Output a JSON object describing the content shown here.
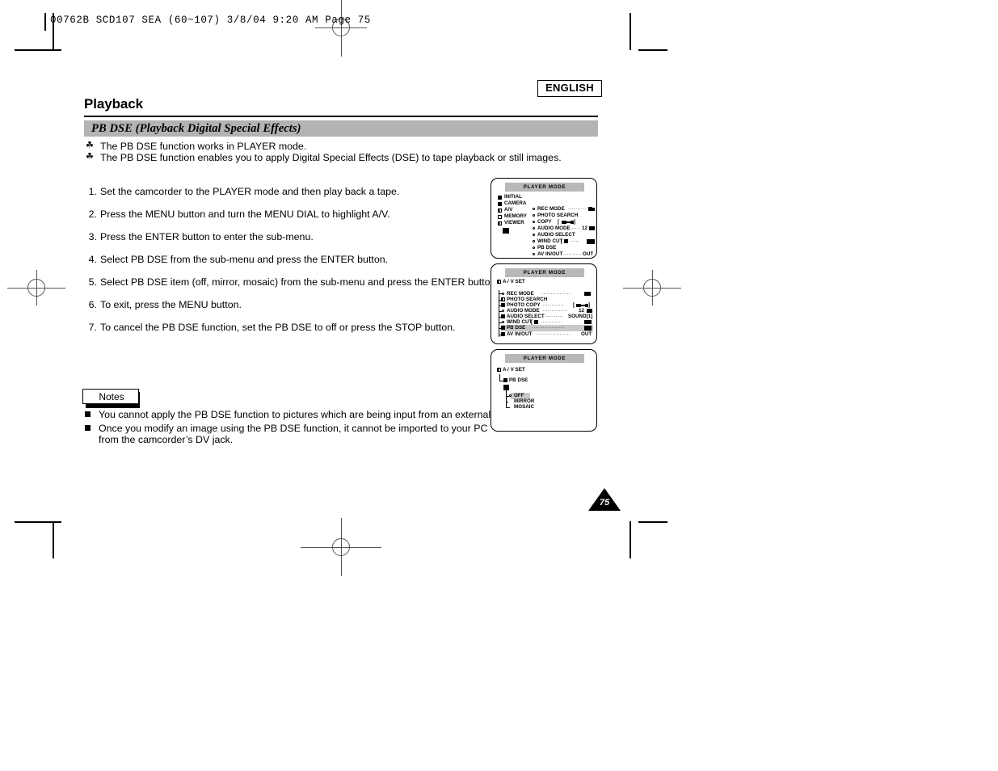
{
  "print_slug": "00762B SCD107 SEA (60~107)   3/8/04 9:20 AM   Page 75",
  "header": {
    "language_badge": "ENGLISH",
    "page_title": "Playback",
    "section_title": "PB DSE (Playback Digital Special Effects)"
  },
  "intro_bullets": [
    {
      "marker": "☘",
      "text": "The PB DSE function works in PLAYER mode."
    },
    {
      "marker": "☘",
      "text": "The PB DSE function enables you to apply Digital Special Effects (DSE) to tape playback or still images."
    }
  ],
  "steps": [
    {
      "num": "1.",
      "text": "Set the camcorder to the PLAYER mode and then play back a tape."
    },
    {
      "num": "2.",
      "text": "Press the MENU button and turn the MENU DIAL to highlight A/V."
    },
    {
      "num": "3.",
      "text": "Press the ENTER button to enter the sub-menu."
    },
    {
      "num": "4.",
      "text": "Select PB DSE from the sub-menu and press the ENTER button."
    },
    {
      "num": "5.",
      "text": "Select PB DSE item (off, mirror, mosaic) from the sub-menu and press the ENTER button."
    },
    {
      "num": "6.",
      "text": "To exit, press the MENU button."
    },
    {
      "num": "7.",
      "text": "To cancel the PB DSE function, set the PB DSE to off or press the STOP button."
    }
  ],
  "notes": {
    "label": "Notes",
    "items": [
      {
        "line1": "You cannot apply the PB DSE function to pictures which are being input from an external source.",
        "line2": ""
      },
      {
        "line1": "Once you modify an image using the PB DSE function, it cannot be imported to your PC",
        "line2": "from the camcorder’s DV jack."
      }
    ]
  },
  "page_number": "75",
  "lcd_screens": [
    {
      "id": "lcd-main-menu",
      "title": "PLAYER MODE",
      "left_column": [
        "INITIAL",
        "CAMERA",
        "A/V",
        "MEMORY",
        "VIEWER"
      ],
      "right_column": [
        {
          "label": "REC MODE",
          "dots": "··········",
          "value": ""
        },
        {
          "label": "PHOTO SEARCH",
          "dots": "",
          "value": ""
        },
        {
          "label": "COPY",
          "dots": "",
          "value": ""
        },
        {
          "label": "AUDIO MODE",
          "dots": "······",
          "value": "12"
        },
        {
          "label": "AUDIO SELECT",
          "dots": "",
          "value": ""
        },
        {
          "label": "WIND CUT",
          "dots": "·····",
          "value": ""
        },
        {
          "label": "PB DSE",
          "dots": "",
          "value": ""
        },
        {
          "label": "AV IN/OUT",
          "dots": "··········",
          "value": "OUT"
        }
      ]
    },
    {
      "id": "lcd-av-set-submenu",
      "title": "PLAYER MODE",
      "breadcrumb": "A / V SET",
      "items": [
        {
          "label": "REC MODE",
          "dots": "················",
          "value": "",
          "highlight": false
        },
        {
          "label": "PHOTO SEARCH",
          "dots": "",
          "value": "",
          "highlight": false
        },
        {
          "label": "PHOTO COPY",
          "dots": "············",
          "value": "",
          "highlight": false
        },
        {
          "label": "AUDIO MODE",
          "dots": "··············",
          "value": "12",
          "highlight": false
        },
        {
          "label": "AUDIO SELECT",
          "dots": "··········",
          "value": "SOUND[1]",
          "highlight": false
        },
        {
          "label": "WIND CUT",
          "dots": "············",
          "value": "",
          "highlight": false
        },
        {
          "label": "PB DSE",
          "dots": "··················",
          "value": "",
          "highlight": true
        },
        {
          "label": "AV IN/OUT",
          "dots": "···················",
          "value": "OUT",
          "highlight": false
        }
      ]
    },
    {
      "id": "lcd-pb-dse-options",
      "title": "PLAYER MODE",
      "breadcrumb": "A / V SET",
      "submenu": "PB DSE",
      "options": [
        {
          "label": "OFF",
          "selected": true
        },
        {
          "label": "MIRROR",
          "selected": false
        },
        {
          "label": "MOSAIC",
          "selected": false
        }
      ]
    }
  ],
  "colors": {
    "section_bar": "#b3b3b3",
    "lcd_title_bar": "#b8b8b8",
    "highlight": "#c8c8c8",
    "ink": "#000000",
    "paper": "#ffffff"
  }
}
